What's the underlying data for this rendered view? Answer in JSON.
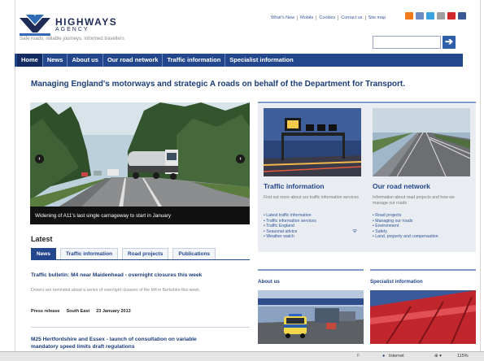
{
  "brand": {
    "name": "HIGHWAYS",
    "sub": "AGENCY",
    "tagline": "Safe roads, reliable journeys, informed travellers"
  },
  "utility_links": [
    "What's New",
    "Mobile",
    "Cookies",
    "Contact us",
    "Site map"
  ],
  "social_icons": [
    {
      "name": "rss-icon",
      "color": "#f27a18"
    },
    {
      "name": "email-icon",
      "color": "#6b8cc4"
    },
    {
      "name": "twitter-icon",
      "color": "#3aa2e0"
    },
    {
      "name": "flickr-icon",
      "color": "#a0a0a0"
    },
    {
      "name": "youtube-icon",
      "color": "#d0282a"
    },
    {
      "name": "facebook-icon",
      "color": "#3b5998"
    }
  ],
  "search": {
    "placeholder": "",
    "button_icon": "search-arrow-icon"
  },
  "nav": [
    "Home",
    "News",
    "About us",
    "Our road network",
    "Traffic information",
    "Specialist information"
  ],
  "headline": "Managing England's motorways and strategic A roads on behalf of the Department for Transport.",
  "hero": {
    "caption": "Widening of A11's last single carriageway to start in January",
    "prev": "‹",
    "next": "›"
  },
  "latest": {
    "title": "Latest",
    "tabs": [
      "News",
      "Traffic information",
      "Road projects",
      "Publications"
    ],
    "articles": [
      {
        "title": "Traffic bulletin: M4 near Maidenhead - overnight closures this week",
        "desc": "Drivers are reminded about a series of overnight closures of the M4 in Berkshire this week.",
        "type": "Press release",
        "region": "South East",
        "date": "23 January 2013"
      },
      {
        "title": "M25 Hertfordshire and Essex - launch of consultation on variable",
        "title2": "mandatory speed limits draft regulations"
      }
    ]
  },
  "panels": [
    {
      "title": "Traffic information",
      "desc": "Find out more about our traffic information services",
      "links": [
        "Latest traffic information",
        "Traffic information services",
        "Traffic England",
        "Seasonal advice",
        "Weather watch"
      ]
    },
    {
      "title": "Our road network",
      "desc": "Information about road projects and how we manage our roads",
      "links": [
        "Road projects",
        "Managing our roads",
        "Environment",
        "Safety",
        "Land, property and compensation"
      ]
    }
  ],
  "sub_sections": [
    "About us",
    "Specialist information"
  ],
  "statusbar": {
    "zone": "Internet",
    "zoom": "115%"
  },
  "colors": {
    "nav": "#23478c",
    "brand": "#1d2b56",
    "link": "#2d5597"
  }
}
